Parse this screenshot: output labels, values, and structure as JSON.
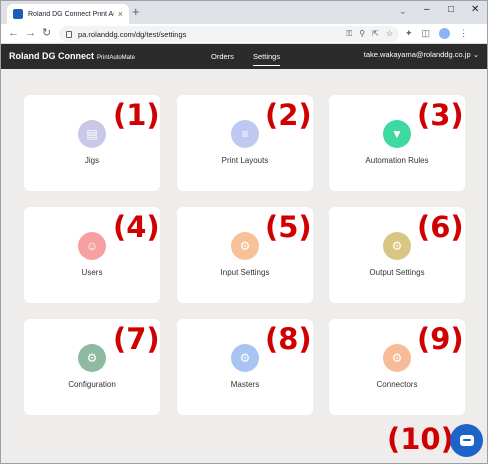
{
  "browser": {
    "tab_title": "Roland DG Connect Print Automa",
    "tab_close": "×",
    "new_tab": "+",
    "url": "pa.rolanddg.com/dg/test/settings"
  },
  "app": {
    "brand": "Roland DG Connect",
    "brand_sub": "PrintAutoMate",
    "nav": [
      {
        "label": "Orders",
        "active": false
      },
      {
        "label": "Settings",
        "active": true
      }
    ],
    "user": "take.wakayama@rolanddg.co.jp"
  },
  "cards": [
    {
      "label": "Jigs",
      "marker": "(1)",
      "icon": "document-icon",
      "color": "#c9c8e8"
    },
    {
      "label": "Print Layouts",
      "marker": "(2)",
      "icon": "list-icon",
      "color": "#bfc8f0"
    },
    {
      "label": "Automation Rules",
      "marker": "(3)",
      "icon": "filter-icon",
      "color": "#3dd9a0"
    },
    {
      "label": "Users",
      "marker": "(4)",
      "icon": "user-icon",
      "color": "#f6a0a0"
    },
    {
      "label": "Input Settings",
      "marker": "(5)",
      "icon": "gear-icon",
      "color": "#f7c29a"
    },
    {
      "label": "Output Settings",
      "marker": "(6)",
      "icon": "gear-icon",
      "color": "#d8c683"
    },
    {
      "label": "Configuration",
      "marker": "(7)",
      "icon": "gear-icon",
      "color": "#8fb9a0"
    },
    {
      "label": "Masters",
      "marker": "(8)",
      "icon": "gear-icon",
      "color": "#a9c3f3"
    },
    {
      "label": "Connectors",
      "marker": "(9)",
      "icon": "gear-icon",
      "color": "#f7bb98"
    }
  ],
  "chat": {
    "marker": "(10)",
    "icon": "chat-icon",
    "color": "#1e64c8"
  }
}
